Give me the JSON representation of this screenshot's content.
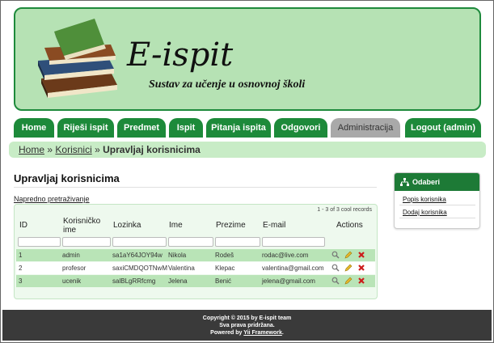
{
  "header": {
    "title": "E-ispit",
    "subtitle": "Sustav za učenje u osnovnoj školi"
  },
  "nav": {
    "items": [
      {
        "label": "Home"
      },
      {
        "label": "Riješi ispit"
      },
      {
        "label": "Predmet"
      },
      {
        "label": "Ispit"
      },
      {
        "label": "Pitanja ispita"
      },
      {
        "label": "Odgovori"
      },
      {
        "label": "Administracija"
      },
      {
        "label": "Logout (admin)"
      }
    ]
  },
  "breadcrumb": {
    "home": "Home",
    "sep": "»",
    "korisnici": "Korisnici",
    "current": "Upravljaj korisnicima"
  },
  "page": {
    "title": "Upravljaj korisnicima",
    "advanced_search": "Napredno pretraživanje"
  },
  "grid": {
    "summary": "1 - 3 of 3 cool records",
    "columns": [
      "ID",
      "Korisničko ime",
      "Lozinka",
      "Ime",
      "Prezime",
      "E-mail",
      "Actions"
    ],
    "rows": [
      {
        "id": "1",
        "username": "admin",
        "password": "sa1aY64JOY94w",
        "ime": "Nikola",
        "prezime": "Rodeš",
        "email": "rodac@live.com"
      },
      {
        "id": "2",
        "username": "profesor",
        "password": "saxiCMDQOTNwM",
        "ime": "Valentina",
        "prezime": "Klepac",
        "email": "valentina@gmail.com"
      },
      {
        "id": "3",
        "username": "ucenik",
        "password": "salBLgRRfcmg",
        "ime": "Jelena",
        "prezime": "Benić",
        "email": "jelena@gmail.com"
      }
    ]
  },
  "sidebar": {
    "title": "Odaberi",
    "links": [
      "Popis korisnika",
      "Dodaj korisnika"
    ]
  },
  "footer": {
    "line1": "Copyright © 2015 by E-ispit team",
    "line2": "Sva prava pridržana.",
    "line3_prefix": "Powered by",
    "line3_link": "Yii Framework",
    "line3_suffix": "."
  },
  "colors": {
    "brand_green": "#1d8a3a",
    "header_bg": "#b6e2b4",
    "active_tab": "#a9a9a9",
    "row_highlight": "#b9e4b7"
  }
}
